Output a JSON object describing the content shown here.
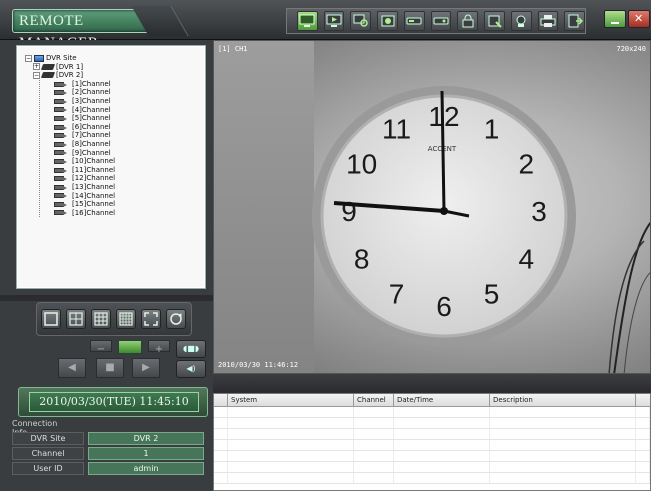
{
  "app": {
    "title": "REMOTE MANAGER"
  },
  "toolbar": {
    "buttons": [
      "monitor-view-icon",
      "playback-icon",
      "search-icon",
      "record-icon",
      "backup-icon",
      "device-icon",
      "lock-icon",
      "setup-icon",
      "snapshot-icon",
      "print-icon",
      "exit-icon"
    ]
  },
  "tree": {
    "root": "DVR Site",
    "nodes": [
      {
        "label": "[DVR 1]",
        "expanded": false
      },
      {
        "label": "[DVR 2]",
        "expanded": true
      }
    ],
    "channels": [
      "[1]Channel",
      "[2]Channel",
      "[3]Channel",
      "[4]Channel",
      "[5]Channel",
      "[6]Channel",
      "[7]Channel",
      "[8]Channel",
      "[9]Channel",
      "[10]Channel",
      "[11]Channel",
      "[12]Channel",
      "[13]Channel",
      "[14]Channel",
      "[15]Channel",
      "[16]Channel"
    ]
  },
  "video": {
    "channel_label": "[1] CH1",
    "resolution": "720x240",
    "timestamp": "2010/03/30 11:46:12"
  },
  "clock": {
    "brand": "ACCENT",
    "numerals": [
      "12",
      "1",
      "2",
      "3",
      "4",
      "5",
      "6",
      "7",
      "8",
      "9",
      "10",
      "11"
    ]
  },
  "datetime": {
    "text": "2010/03/30(TUE) 11:45:10"
  },
  "connection": {
    "title": "Connection Info",
    "rows": [
      {
        "label": "DVR Site",
        "value": "DVR 2"
      },
      {
        "label": "Channel",
        "value": "1"
      },
      {
        "label": "User ID",
        "value": "admin"
      }
    ]
  },
  "log": {
    "columns": [
      "",
      "System",
      "Channel",
      "Date/Time",
      "Description",
      ""
    ]
  }
}
